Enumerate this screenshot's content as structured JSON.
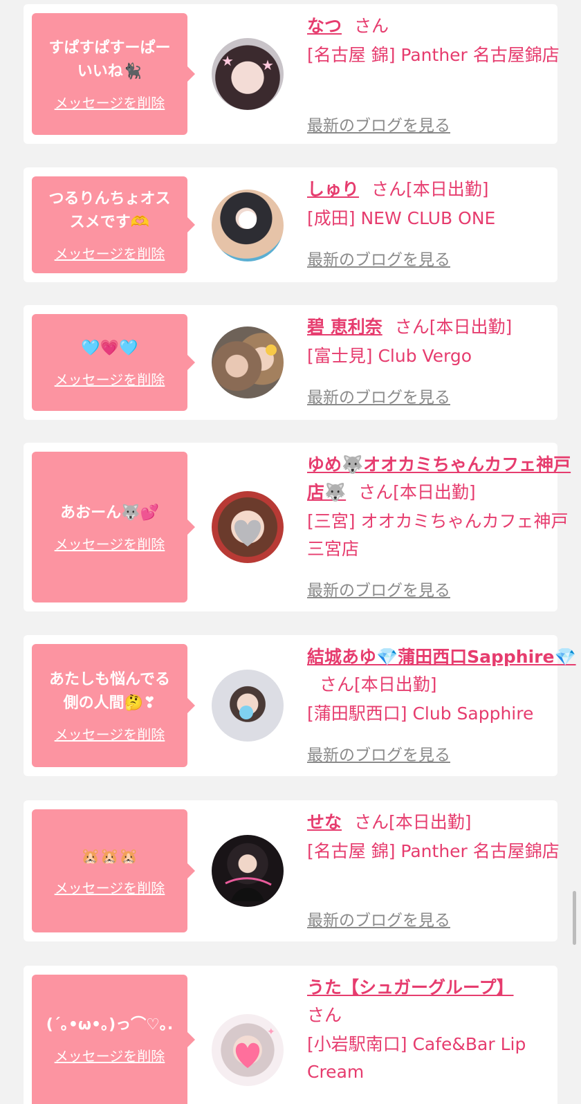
{
  "colors": {
    "accent": "#e63c6e",
    "message_bubble": "#fc94a1",
    "blog_link": "#8a8a8a",
    "background": "#f2f2f2"
  },
  "delete_label": "メッセージを削除",
  "blog_label": "最新のブログを見る",
  "honorific": "さん",
  "entries": [
    {
      "message": "すぱすぱすーぱー\nいいね🐈‍⬛",
      "name": "なつ",
      "status": "",
      "shop": "[名古屋 錦] Panther 名古屋錦店"
    },
    {
      "message": "つるりんちょオス\nスメです🫶",
      "name": "しゅり",
      "status": "[本日出勤]",
      "shop": "[成田] NEW CLUB ONE"
    },
    {
      "message": "🩵💗🩵",
      "name": "碧 恵利奈",
      "status": "[本日出勤]",
      "shop": "[富士見] Club Vergo"
    },
    {
      "message": "あおーん🐺💕",
      "name": "ゆめ🐺オオカミちゃんカフェ神戸店🐺",
      "status": "[本日出勤]",
      "shop": "[三宮] オオカミちゃんカフェ神戸三宮店"
    },
    {
      "message": "あたしも悩んでる\n側の人間🤔❣",
      "name": "結城あゆ💎蒲田西口Sapphire💎",
      "status": "[本日出勤]",
      "shop": "[蒲田駅西口] Club Sapphire"
    },
    {
      "message": "🐹🐹🐹",
      "name": "せな",
      "status": "[本日出勤]",
      "shop": "[名古屋 錦] Panther 名古屋錦店"
    },
    {
      "message": "(´｡•ω•｡)っ⌒♡｡.",
      "name": "うた【シュガーグループ】",
      "status": "",
      "shop": "[小岩駅南口] Cafe&Bar Lip Cream"
    }
  ]
}
